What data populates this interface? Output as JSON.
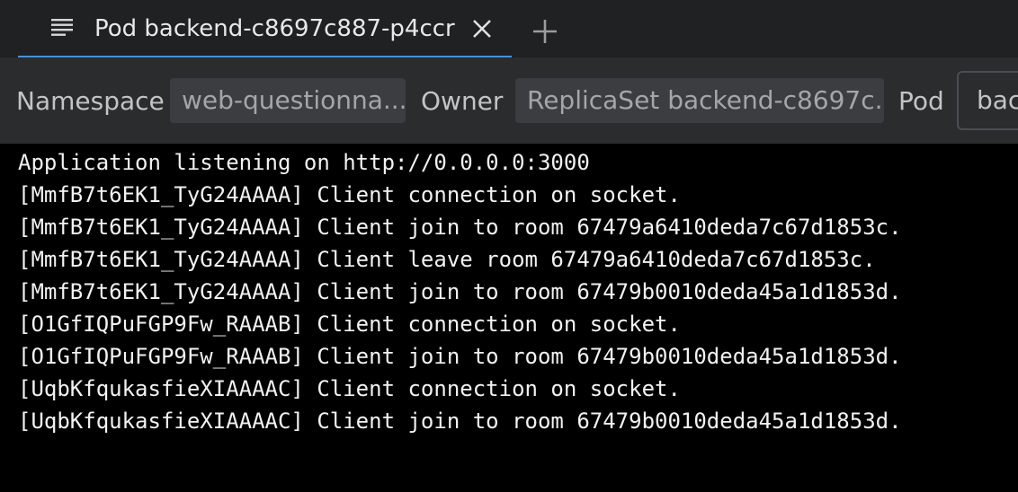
{
  "tab": {
    "title": "Pod backend-c8697c887-p4ccr",
    "menu_icon": "menu-lines-icon",
    "close_icon": "close-icon",
    "add_icon": "plus-icon"
  },
  "toolbar": {
    "namespace_label": "Namespace",
    "namespace_value": "web-questionna...",
    "owner_label": "Owner",
    "owner_value": "ReplicaSet backend-c8697c...",
    "pod_label": "Pod",
    "pod_value": "bac"
  },
  "log": {
    "lines": [
      "Application listening on http://0.0.0.0:3000",
      "[MmfB7t6EK1_TyG24AAAA] Client connection on socket.",
      "[MmfB7t6EK1_TyG24AAAA] Client join to room 67479a6410deda7c67d1853c.",
      "[MmfB7t6EK1_TyG24AAAA] Client leave room 67479a6410deda7c67d1853c.",
      "[MmfB7t6EK1_TyG24AAAA] Client join to room 67479b0010deda45a1d1853d.",
      "[O1GfIQPuFGP9Fw_RAAAB] Client connection on socket.",
      "[O1GfIQPuFGP9Fw_RAAAB] Client join to room 67479b0010deda45a1d1853d.",
      "[UqbKfqukasfieXIAAAAC] Client connection on socket.",
      "[UqbKfqukasfieXIAAAAC] Client join to room 67479b0010deda45a1d1853d."
    ]
  },
  "colors": {
    "tab_underline": "#4a90d9",
    "tabbar_bg": "#1f2123",
    "toolbar_bg": "#2a2c2e",
    "log_bg": "#000000"
  }
}
